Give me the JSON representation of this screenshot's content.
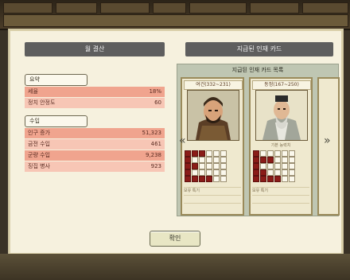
{
  "left": {
    "title": "월 결산",
    "summary_label": "요약",
    "summary_rows": [
      {
        "label": "세율",
        "value": "18%"
      },
      {
        "label": "정치 안정도",
        "value": "60"
      }
    ],
    "income_label": "수입",
    "income_rows": [
      {
        "label": "인구 증가",
        "value": "51,323"
      },
      {
        "label": "금전 수입",
        "value": "461"
      },
      {
        "label": "군량 수입",
        "value": "9,238"
      },
      {
        "label": "징집 병사",
        "value": "923"
      }
    ]
  },
  "right": {
    "title": "지급된 인재 카드",
    "list_title": "지급된 인재 카드 목록",
    "cards": [
      {
        "name": "여건(332~231)",
        "subtitle": "",
        "footer_lines": [
          "보유 특기"
        ]
      },
      {
        "name": "동정(167~250)",
        "subtitle": "기본 능력치",
        "footer_lines": [
          "보유 특기"
        ]
      }
    ]
  },
  "confirm_label": "확인",
  "colors": {
    "row_dark": "#f0a48e",
    "row_light": "#f7c6b5",
    "header": "#5e5e5e"
  }
}
